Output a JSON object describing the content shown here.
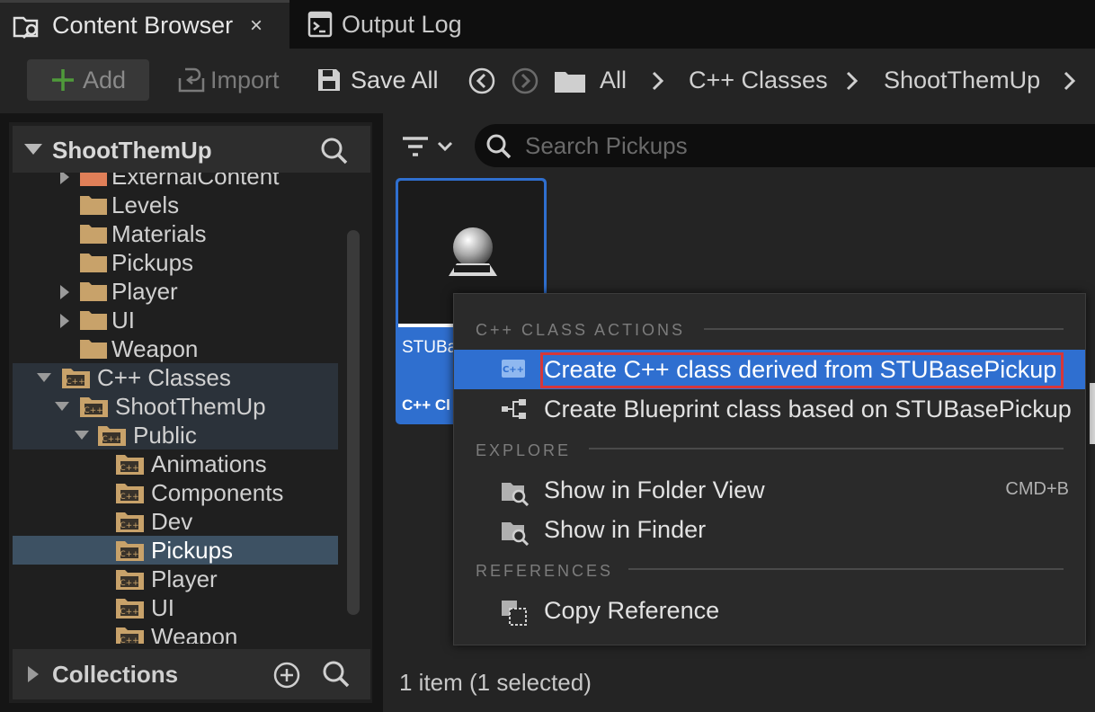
{
  "tabs": [
    {
      "label": "Content Browser",
      "icon": "folder-search-icon",
      "close": "×"
    },
    {
      "label": "Output Log",
      "icon": "terminal-icon"
    }
  ],
  "toolbar": {
    "add_label": "Add",
    "import_label": "Import",
    "save_all_label": "Save All"
  },
  "breadcrumb": [
    "All",
    "C++ Classes",
    "ShootThemUp"
  ],
  "sources": {
    "header": "ShootThemUp",
    "tree": [
      {
        "label": "ExternalContent",
        "depth": 0
      },
      {
        "label": "Levels",
        "depth": 0
      },
      {
        "label": "Materials",
        "depth": 0
      },
      {
        "label": "Pickups",
        "depth": 0
      },
      {
        "label": "Player",
        "depth": 0
      },
      {
        "label": "UI",
        "depth": 0
      },
      {
        "label": "Weapon",
        "depth": 0
      },
      {
        "label": "C++ Classes",
        "depth": 0
      },
      {
        "label": "ShootThemUp",
        "depth": 1
      },
      {
        "label": "Public",
        "depth": 2
      },
      {
        "label": "Animations",
        "depth": 3
      },
      {
        "label": "Components",
        "depth": 3
      },
      {
        "label": "Dev",
        "depth": 3
      },
      {
        "label": "Pickups",
        "depth": 3,
        "selected": true
      },
      {
        "label": "Player",
        "depth": 3
      },
      {
        "label": "UI",
        "depth": 3
      },
      {
        "label": "Weapon",
        "depth": 3
      }
    ],
    "collections_label": "Collections"
  },
  "search": {
    "placeholder": "Search Pickups"
  },
  "asset": {
    "name_visible": "STUBa",
    "type_visible": "C++ Cl"
  },
  "status": "1 item (1 selected)",
  "context_menu": {
    "sections": [
      {
        "title": "C++ CLASS ACTIONS"
      },
      {
        "title": "EXPLORE"
      },
      {
        "title": "REFERENCES"
      }
    ],
    "items": {
      "create_cpp": "Create C++ class derived from STUBasePickup",
      "create_bp": "Create Blueprint class based on STUBasePickup",
      "show_folder": "Show in Folder View",
      "show_folder_shortcut": "CMD+B",
      "show_finder": "Show in Finder",
      "copy_ref": "Copy Reference"
    }
  },
  "colors": {
    "accent": "#2f6fd0",
    "highlight_outline": "#d6373a",
    "folder": "#c8a26a",
    "selection": "#3d5163"
  }
}
